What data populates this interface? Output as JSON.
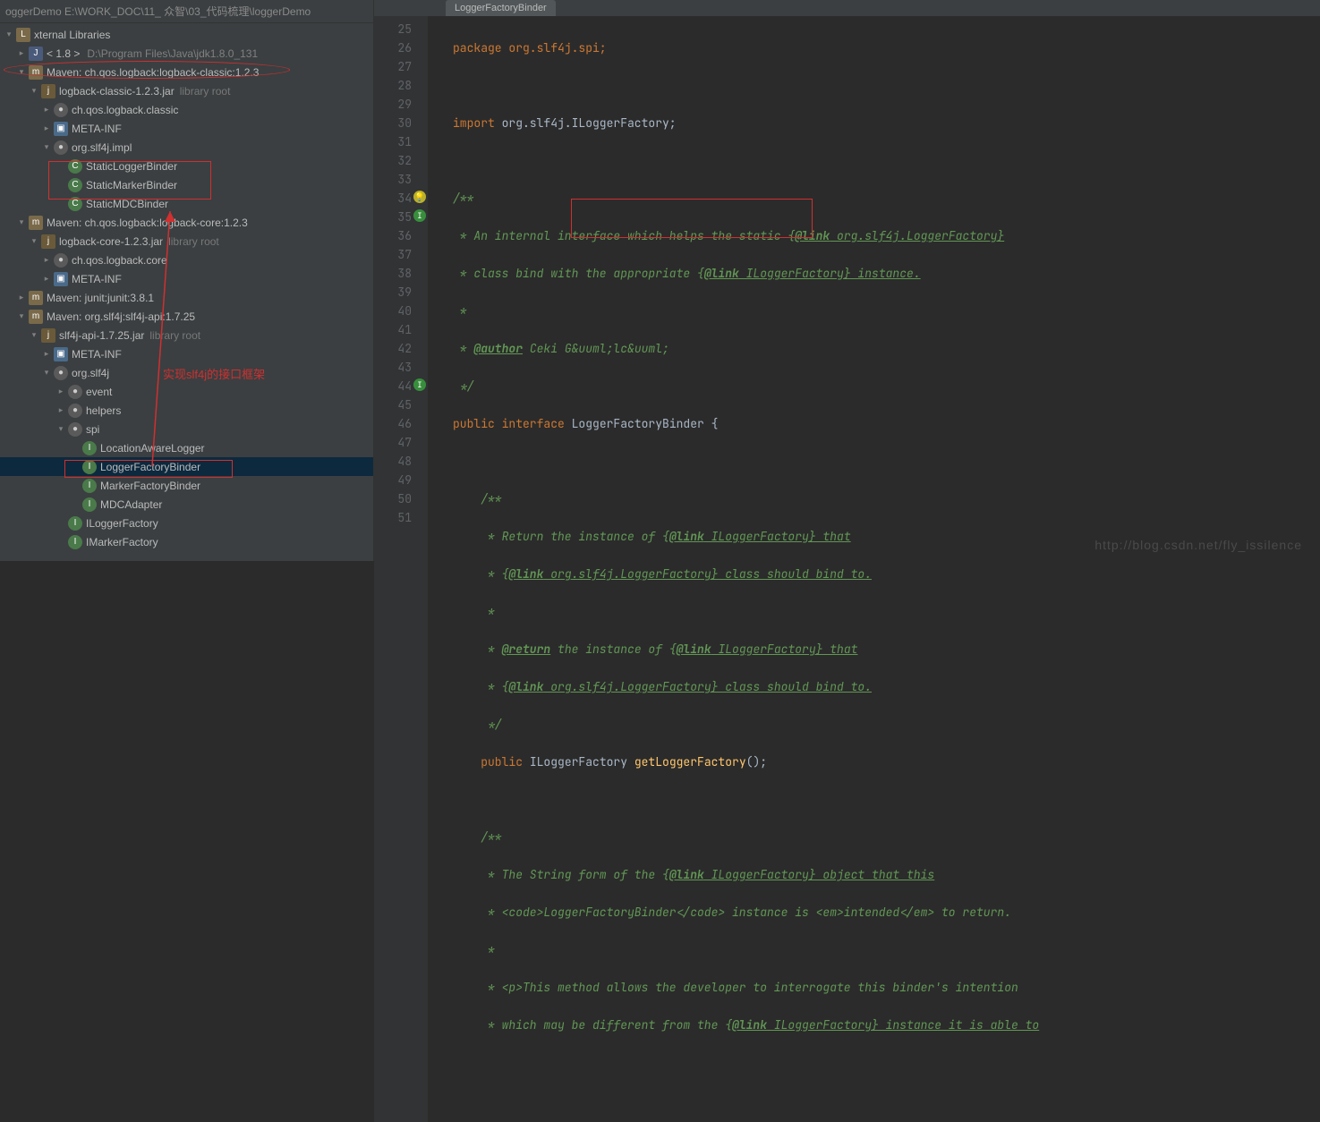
{
  "breadcrumb": "oggerDemo  E:\\WORK_DOC\\11_ 众智\\03_代码梳理\\loggerDemo",
  "ext_lib": "xternal Libraries",
  "tree": {
    "jdk": {
      "label": "< 1.8 >",
      "path": "D:\\Program Files\\Java\\jdk1.8.0_131"
    },
    "maven_classic": "Maven: ch.qos.logback:logback-classic:1.2.3",
    "logback_classic_jar": "logback-classic-1.2.3.jar",
    "library_root": "library root",
    "pkg_classic": "ch.qos.logback.classic",
    "metainf": "META-INF",
    "pkg_impl": "org.slf4j.impl",
    "slb": "StaticLoggerBinder",
    "smb": "StaticMarkerBinder",
    "smdcb": "StaticMDCBinder",
    "maven_core": "Maven: ch.qos.logback:logback-core:1.2.3",
    "logback_core_jar": "logback-core-1.2.3.jar",
    "pkg_core": "ch.qos.logback.core",
    "maven_junit": "Maven: junit:junit:3.8.1",
    "maven_slf4j": "Maven: org.slf4j:slf4j-api:1.7.25",
    "slf4j_jar": "slf4j-api-1.7.25.jar",
    "pkg_slf4j": "org.slf4j",
    "event": "event",
    "helpers": "helpers",
    "spi": "spi",
    "lal": "LocationAwareLogger",
    "lfb": "LoggerFactoryBinder",
    "mfb": "MarkerFactoryBinder",
    "mdca": "MDCAdapter",
    "ilf": "ILoggerFactory",
    "imf": "IMarkerFactory"
  },
  "tab": "LoggerFactoryBinder",
  "code": {
    "l25": "package org.slf4j.spi;",
    "l27_a": "import ",
    "l27_b": "org.slf4j.ILoggerFactory;",
    "l29": "/**",
    "l30_a": " * An internal interface which helps the static {",
    "l30_link": "@link",
    "l30_b": " org.slf4j.LoggerFactory}",
    "l31_a": " * class bind with the appropriate {",
    "l31_link": "@link",
    "l31_b": " ILoggerFactory} instance.",
    "l32": " *",
    "l33_a": " * ",
    "l33_tag": "@author",
    "l33_b": " Ceki G&uuml;lc&uuml;",
    "l34": " */",
    "l35_a": "public ",
    "l35_b": "interface ",
    "l35_c": "LoggerFactoryBinder ",
    "l35_d": "{",
    "l37": "    /**",
    "l38_a": "     * Return the instance of {",
    "l38_link": "@link",
    "l38_b": " ILoggerFactory} that",
    "l39_a": "     * {",
    "l39_link": "@link",
    "l39_b": " org.slf4j.LoggerFactory} class should bind to.",
    "l40": "     *",
    "l41_a": "     * ",
    "l41_tag": "@return",
    "l41_b": " the instance of {",
    "l41_link": "@link",
    "l41_c": " ILoggerFactory} that",
    "l42_a": "     * {",
    "l42_link": "@link",
    "l42_b": " org.slf4j.LoggerFactory} class should bind to.",
    "l43": "     */",
    "l44_a": "    public ",
    "l44_b": "ILoggerFactory ",
    "l44_c": "getLoggerFactory",
    "l44_d": "();",
    "l46": "    /**",
    "l47_a": "     * The String form of the {",
    "l47_link": "@link",
    "l47_b": " ILoggerFactory} object that this",
    "l48": "     * <code>LoggerFactoryBinder</code> instance is <em>intended</em> to return.",
    "l49": "     *",
    "l50": "     * <p>This method allows the developer to interrogate this binder's intention",
    "l51_a": "     * which may be different from the {",
    "l51_link": "@link",
    "l51_b": " ILoggerFactory} instance it is able to"
  },
  "annotation_text": "实现slf4j的接口框架",
  "watermark": "http://blog.csdn.net/fly_issilence"
}
